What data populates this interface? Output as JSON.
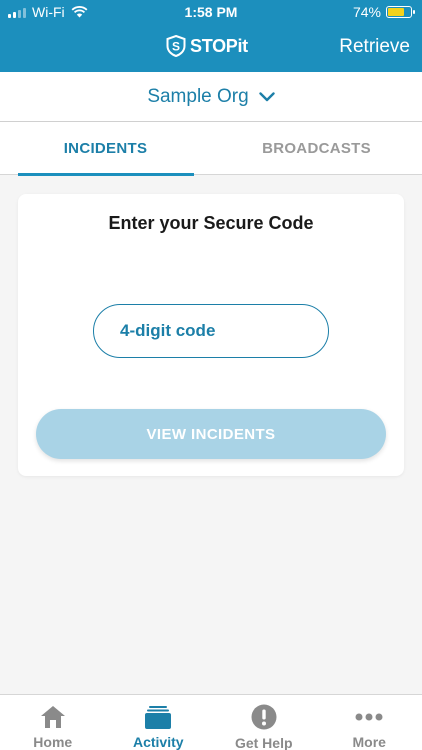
{
  "status_bar": {
    "carrier": "Wi-Fi",
    "time": "1:58 PM",
    "battery_percent": "74%",
    "battery_level": 0.74
  },
  "header": {
    "logo_text": "STOPit",
    "retrieve_label": "Retrieve"
  },
  "org_selector": {
    "name": "Sample Org"
  },
  "tabs": [
    {
      "label": "INCIDENTS",
      "active": true
    },
    {
      "label": "BROADCASTS",
      "active": false
    }
  ],
  "secure_code": {
    "title": "Enter your Secure Code",
    "placeholder": "4-digit code",
    "value": "",
    "button_label": "VIEW INCIDENTS"
  },
  "bottom_nav": [
    {
      "label": "Home",
      "icon": "home-icon",
      "active": false
    },
    {
      "label": "Activity",
      "icon": "activity-icon",
      "active": true
    },
    {
      "label": "Get Help",
      "icon": "alert-icon",
      "active": false
    },
    {
      "label": "More",
      "icon": "more-icon",
      "active": false
    }
  ],
  "colors": {
    "brand": "#1c8fbd",
    "accent_text": "#1c7fa8",
    "button_disabled": "#a9d3e6",
    "battery": "#f5d21a"
  }
}
